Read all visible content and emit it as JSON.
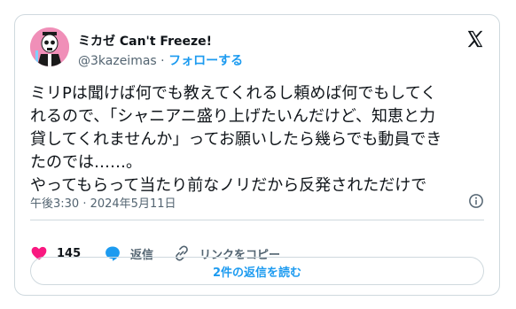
{
  "tweet": {
    "author_name": "ミカゼ Can't Freeze!",
    "author_handle": "@3kazeimas",
    "separator": "·",
    "follow_label": "フォローする",
    "body_lines": [
      "ミリPは聞けば何でも教えてくれるし頼めば何でもしてく",
      "れるので、「シャニアニ盛り上げたいんだけど、知恵と力",
      "貸してくれませんか」ってお願いしたら幾らでも動員でき",
      "たのでは……。",
      "やってもらって当たり前なノリだから反発されただけで"
    ],
    "timestamp": "午後3:30 · 2024年5月11日"
  },
  "actions": {
    "likes_count": "145",
    "reply_label": "返信",
    "copy_link_label": "リンクをコピー",
    "read_replies_label": "2件の返信を読む"
  },
  "colors": {
    "accent": "#1d9bf0",
    "like": "#f91880",
    "avatar_bg": "#f08fb8",
    "text": "#0f1419",
    "secondary": "#536471",
    "border": "#cfd9de"
  },
  "icons": [
    "avatar",
    "x-logo",
    "info-icon",
    "heart-icon",
    "reply-icon",
    "link-icon"
  ]
}
